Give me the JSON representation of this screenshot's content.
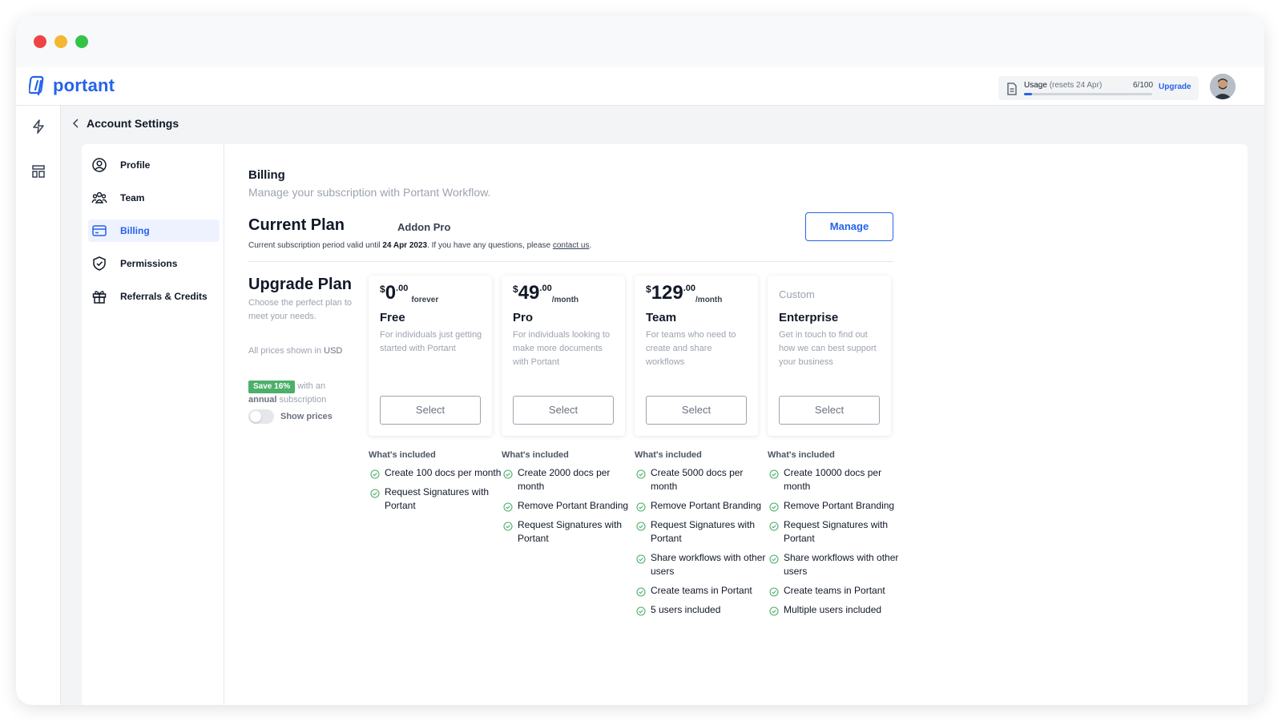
{
  "app": {
    "logo_text": "portant",
    "brand_color": "#2563eb"
  },
  "usage": {
    "label": "Usage",
    "reset_note": "(resets 24 Apr)",
    "count": "6/100",
    "used": 6,
    "limit": 100,
    "upgrade_label": "Upgrade"
  },
  "breadcrumb": {
    "title": "Account Settings"
  },
  "sidebar": {
    "items": [
      {
        "label": "Profile",
        "icon": "user-circle-icon",
        "active": false
      },
      {
        "label": "Team",
        "icon": "users-icon",
        "active": false
      },
      {
        "label": "Billing",
        "icon": "credit-card-icon",
        "active": true
      },
      {
        "label": "Permissions",
        "icon": "shield-check-icon",
        "active": false
      },
      {
        "label": "Referrals & Credits",
        "icon": "gift-icon",
        "active": false
      }
    ]
  },
  "billing": {
    "title": "Billing",
    "subtitle": "Manage your subscription with Portant Workflow.",
    "current_plan_label": "Current Plan",
    "current_plan_name": "Addon Pro",
    "note_prefix": "Current subscription period valid until ",
    "note_date": "24 Apr 2023",
    "note_middle": ". If you have any questions, please ",
    "note_link": "contact us",
    "note_suffix": ".",
    "manage_label": "Manage"
  },
  "upgrade": {
    "title": "Upgrade Plan",
    "subtitle": "Choose the perfect plan to meet your needs.",
    "currency_note_prefix": "All prices shown in ",
    "currency": "USD",
    "save_badge": "Save 16%",
    "save_text_1": " with an ",
    "save_annual": "annual",
    "save_text_2": " subscription",
    "toggle_label": "Show prices",
    "toggle_on": false
  },
  "plans": [
    {
      "currency_symbol": "$",
      "amount": "0",
      "cents": ".00",
      "period": "forever",
      "name": "Free",
      "description": "For individuals just getting started with Portant",
      "select_label": "Select",
      "features_title": "What's included",
      "features": [
        "Create 100 docs per month",
        "Request Signatures with Portant"
      ]
    },
    {
      "currency_symbol": "$",
      "amount": "49",
      "cents": ".00",
      "period": "/month",
      "name": "Pro",
      "description": "For individuals looking to make more documents with Portant",
      "select_label": "Select",
      "features_title": "What's included",
      "features": [
        "Create 2000 docs per month",
        "Remove Portant Branding",
        "Request Signatures with Portant"
      ]
    },
    {
      "currency_symbol": "$",
      "amount": "129",
      "cents": ".00",
      "period": "/month",
      "name": "Team",
      "description": "For teams who need to create and share workflows",
      "select_label": "Select",
      "features_title": "What's included",
      "features": [
        "Create 5000 docs per month",
        "Remove Portant Branding",
        "Request Signatures with Portant",
        "Share workflows with other users",
        "Create teams in Portant",
        "5 users included"
      ]
    },
    {
      "custom_label": "Custom",
      "name": "Enterprise",
      "description": "Get in touch to find out how we can best support your business",
      "select_label": "Select",
      "features_title": "What's included",
      "features": [
        "Create 10000 docs per month",
        "Remove Portant Branding",
        "Request Signatures with Portant",
        "Share workflows with other users",
        "Create teams in Portant",
        "Multiple users included"
      ]
    }
  ]
}
